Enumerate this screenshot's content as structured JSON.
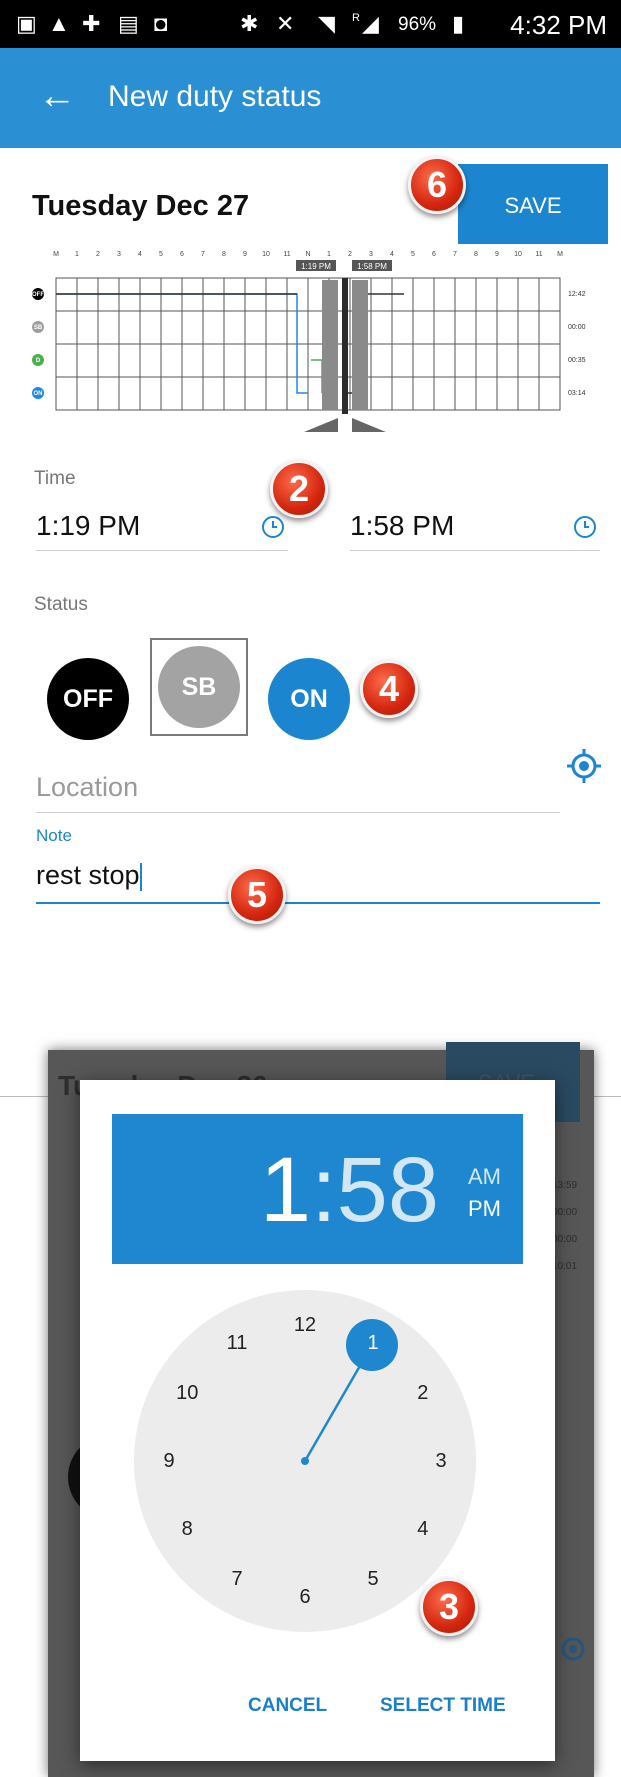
{
  "status_bar": {
    "icons": [
      "image-icon",
      "warning-icon",
      "medical-icon",
      "clipboard-icon",
      "briefcase-icon",
      "bluetooth-icon",
      "mute-icon",
      "wifi-icon",
      "signal-icon",
      "battery-charging-icon"
    ],
    "roaming_mark": "R",
    "battery_percent": "96%",
    "time": "4:32 PM"
  },
  "app_bar": {
    "back_icon": "arrow-back-icon",
    "title": "New duty status",
    "color": "#2a8fd3"
  },
  "editor": {
    "date": "Tuesday Dec 27",
    "save_label": "SAVE",
    "graph": {
      "hour_labels": [
        "M",
        "1",
        "2",
        "3",
        "4",
        "5",
        "6",
        "7",
        "8",
        "9",
        "10",
        "11",
        "N",
        "1",
        "2",
        "3",
        "4",
        "5",
        "6",
        "7",
        "8",
        "9",
        "10",
        "11",
        "M"
      ],
      "rows": [
        "OFF",
        "SB",
        "D",
        "ON"
      ],
      "row_colors": [
        "#000000",
        "#9e9e9e",
        "#4caf50",
        "#1e88e5"
      ],
      "totals": [
        "12:42",
        "00:00",
        "00:35",
        "03:14"
      ],
      "selection_start_label": "1:19 PM",
      "selection_end_label": "1:58 PM"
    },
    "time_label": "Time",
    "start_time": "1:19 PM",
    "end_time": "1:58 PM",
    "status_label": "Status",
    "statuses": [
      "OFF",
      "SB",
      "ON"
    ],
    "selected_status": "SB",
    "location_placeholder": "Location",
    "note_label": "Note",
    "note_value": "rest stop",
    "markers": [
      "2",
      "4",
      "5",
      "6"
    ]
  },
  "background_screen": {
    "date": "Tuesday Dec 26",
    "save_label": "SAVE",
    "totals": [
      "13:59",
      "00:00",
      "00:00",
      "10:01"
    ]
  },
  "time_picker": {
    "hour": "1",
    "separator": ":",
    "minute": "58",
    "am": "AM",
    "pm": "PM",
    "selected_period": "PM",
    "dial_numbers": [
      "12",
      "1",
      "2",
      "3",
      "4",
      "5",
      "6",
      "7",
      "8",
      "9",
      "10",
      "11"
    ],
    "selected_number": "1",
    "cancel_label": "CANCEL",
    "select_label": "SELECT TIME",
    "marker": "3",
    "accent": "#1f87cf"
  }
}
